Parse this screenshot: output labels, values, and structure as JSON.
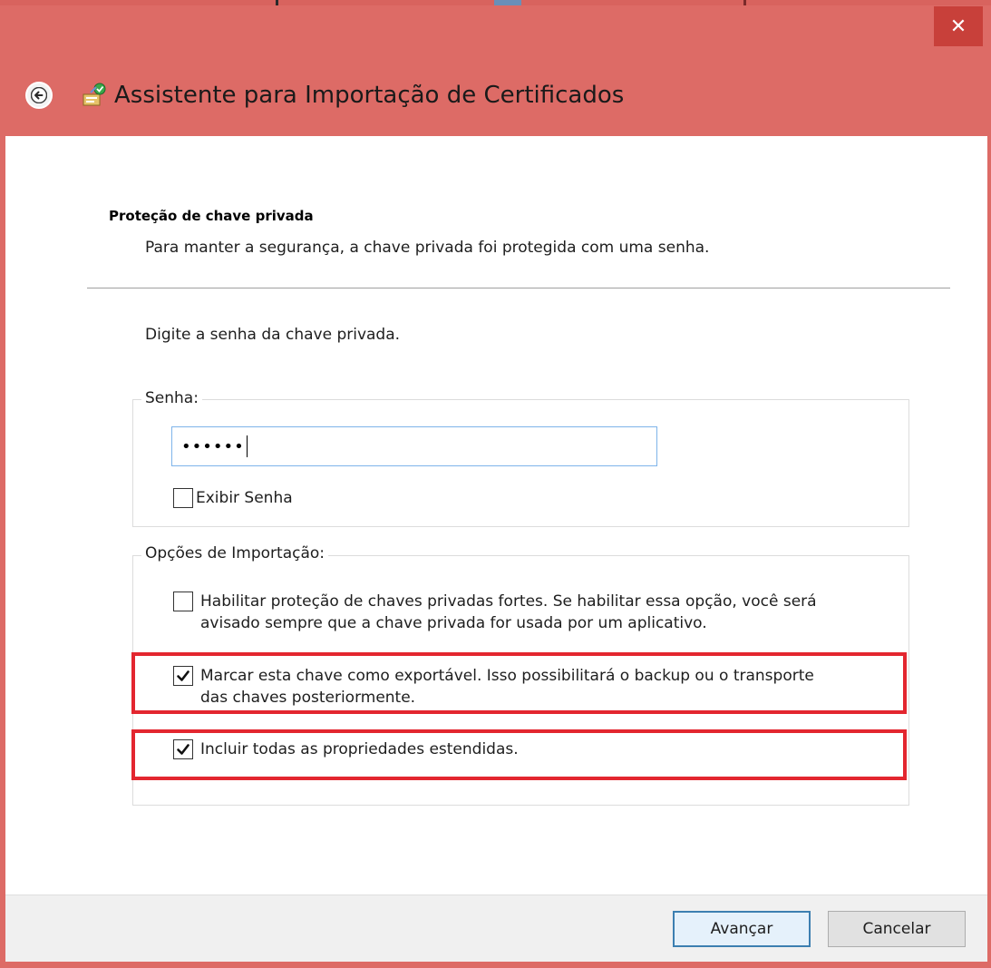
{
  "window": {
    "title": "Assistente para Importação de Certificados",
    "close_glyph": "✕"
  },
  "page": {
    "section_title": "Proteção de chave privada",
    "section_description": "Para manter a segurança, a chave privada foi protegida com uma senha.",
    "prompt": "Digite a senha da chave privada."
  },
  "password_group": {
    "legend": "Senha:",
    "value": "••••••",
    "show_password_label": "Exibir Senha",
    "show_password_checked": false
  },
  "import_options": {
    "legend": "Opções de Importação:",
    "options": [
      {
        "line1": "Habilitar proteção de chaves privadas fortes. Se habilitar essa opção, você será",
        "line2": "avisado sempre que a chave privada for usada por um aplicativo.",
        "checked": false
      },
      {
        "line1": "Marcar esta chave como exportável. Isso possibilitará o backup ou o transporte",
        "line2": "das chaves posteriormente.",
        "checked": true
      },
      {
        "line1": "Incluir todas as propriedades estendidas.",
        "line2": "",
        "checked": true
      }
    ]
  },
  "buttons": {
    "next": "Avançar",
    "cancel": "Cancelar"
  },
  "colors": {
    "title_bar": "#dd6b66",
    "close_button": "#c8403a",
    "highlight": "#e3262f",
    "input_focus": "#7eb4ea"
  },
  "icons": {
    "back": "back-arrow-icon",
    "wizard": "certificate-wizard-icon",
    "close": "close-icon",
    "checkmark": "checkmark-icon"
  }
}
